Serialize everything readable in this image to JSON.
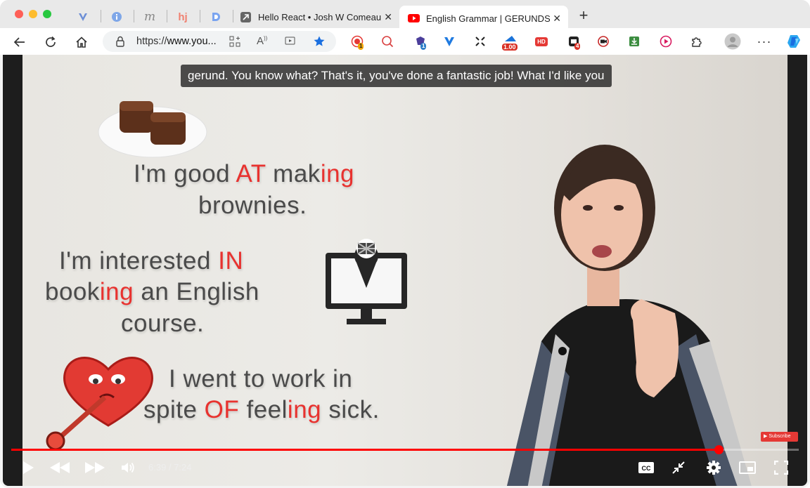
{
  "tabs": [
    {
      "label": "Hello React • Josh W Comeau",
      "favicon": "arrow-box-icon"
    },
    {
      "label": "English Grammar | GERUNDS in",
      "favicon": "youtube-icon"
    }
  ],
  "pinned_tab_icons": [
    "v-icon",
    "info-icon",
    "m-icon",
    "hj-icon",
    "d-icon"
  ],
  "address": {
    "scheme": "https://",
    "host": "www.you..."
  },
  "extensions": [
    {
      "icon": "record-icon",
      "badge": "1"
    },
    {
      "icon": "chart-search-icon",
      "badge": ""
    },
    {
      "icon": "puzzle-badge-icon",
      "badge": "1"
    },
    {
      "icon": "v-check-icon",
      "badge": ""
    },
    {
      "icon": "arrows-icon",
      "badge": ""
    },
    {
      "icon": "speed-icon",
      "badge": "1.00"
    },
    {
      "icon": "hd-icon",
      "badge": ""
    },
    {
      "icon": "ubo-icon",
      "badge": "4"
    },
    {
      "icon": "camera-icon",
      "badge": ""
    },
    {
      "icon": "download-icon",
      "badge": ""
    },
    {
      "icon": "play-circle-icon",
      "badge": ""
    },
    {
      "icon": "extensions-icon",
      "badge": ""
    }
  ],
  "video": {
    "caption": "gerund. You know what? That's it, you've done a fantastic job! What I'd like you",
    "time": "6:39 / 7:24",
    "progress_fraction": 0.898,
    "subscribe": "Subscribe",
    "lines": [
      {
        "parts": [
          [
            "I'm good ",
            false
          ],
          [
            "AT",
            true
          ],
          [
            " mak",
            false
          ],
          [
            "ing",
            true
          ]
        ]
      },
      {
        "parts": [
          [
            "brownies.",
            false
          ]
        ]
      },
      {
        "parts": [
          [
            "I'm interested ",
            false
          ],
          [
            "IN",
            true
          ]
        ]
      },
      {
        "parts": [
          [
            "book",
            false
          ],
          [
            "ing",
            true
          ],
          [
            " an English",
            false
          ]
        ]
      },
      {
        "parts": [
          [
            "course.",
            false
          ]
        ]
      },
      {
        "parts": [
          [
            "I went to work in",
            false
          ]
        ]
      },
      {
        "parts": [
          [
            "spite ",
            false
          ],
          [
            "OF",
            true
          ],
          [
            " feel",
            false
          ],
          [
            "ing",
            true
          ],
          [
            " sick.",
            false
          ]
        ]
      }
    ]
  },
  "colors": {
    "accent": "#ff0000",
    "highlight": "#e8322f",
    "edge_blue": "#0a7cff"
  }
}
